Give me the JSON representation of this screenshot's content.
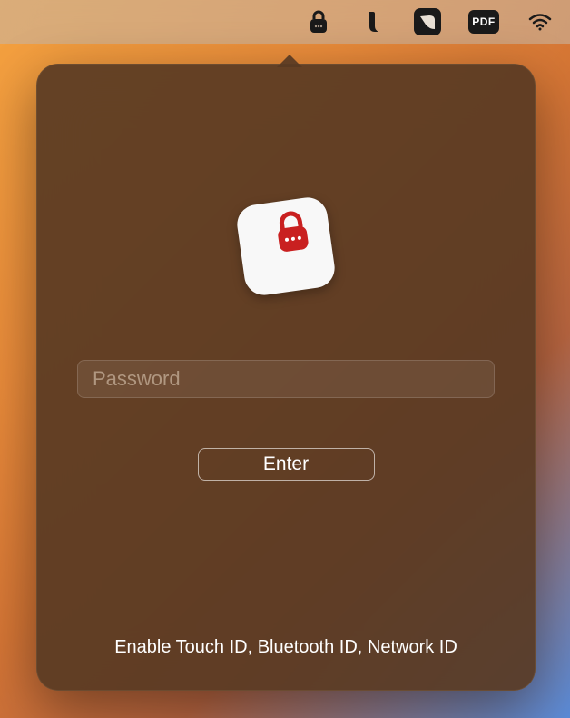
{
  "menubar": {
    "icons": [
      {
        "name": "lock-icon"
      },
      {
        "name": "phone-icon"
      },
      {
        "name": "bird-icon"
      },
      {
        "name": "pdf-icon",
        "label": "PDF"
      },
      {
        "name": "wifi-icon"
      }
    ]
  },
  "popup": {
    "password": {
      "placeholder": "Password",
      "value": ""
    },
    "enter_label": "Enter",
    "bottom_link": "Enable Touch ID, Bluetooth ID, Network ID"
  }
}
